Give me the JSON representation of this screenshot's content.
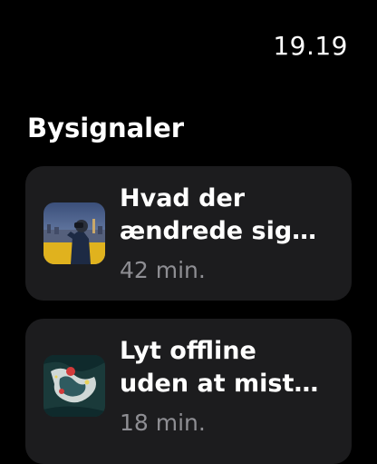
{
  "status": {
    "time": "19.19"
  },
  "section": {
    "title": "Bysignaler"
  },
  "episodes": [
    {
      "title_line1": "Hvad der",
      "title_line2": "ændrede sig…",
      "duration": "42 min.",
      "artwork_icon": "city-portrait-artwork"
    },
    {
      "title_line1": "Lyt offline",
      "title_line2": "uden at mist…",
      "duration": "18 min.",
      "artwork_icon": "abstract-map-artwork"
    }
  ],
  "colors": {
    "background": "#000000",
    "card": "#1c1c1e",
    "secondary_text": "#8e8e93"
  }
}
